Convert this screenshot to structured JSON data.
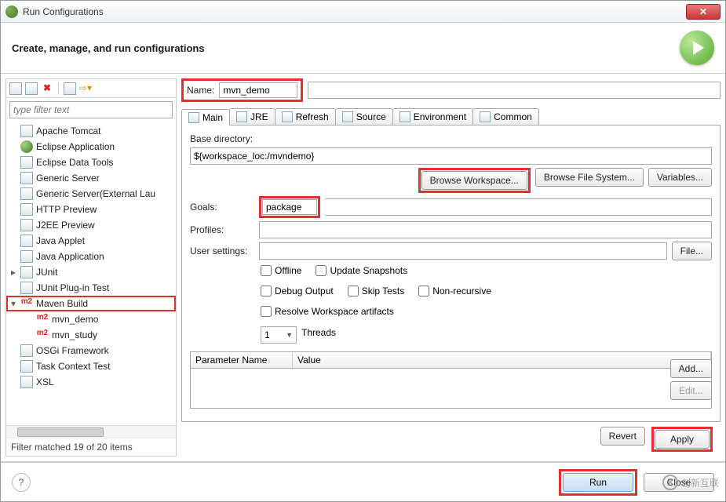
{
  "window": {
    "title": "Run Configurations",
    "close_glyph": "✕"
  },
  "header": {
    "text": "Create, manage, and run configurations"
  },
  "toolbar_icons": [
    "new-icon",
    "copy-icon",
    "delete-icon",
    "collapse-icon",
    "filter-icon"
  ],
  "filter": {
    "placeholder": "type filter text"
  },
  "tree": [
    {
      "label": "Apache Tomcat",
      "icon": "tomcat-icon"
    },
    {
      "label": "Eclipse Application",
      "icon": "eclipse-icon"
    },
    {
      "label": "Eclipse Data Tools",
      "icon": "db-icon"
    },
    {
      "label": "Generic Server",
      "icon": "server-icon"
    },
    {
      "label": "Generic Server(External Lau",
      "icon": "server-icon"
    },
    {
      "label": "HTTP Preview",
      "icon": "http-icon"
    },
    {
      "label": "J2EE Preview",
      "icon": "j2ee-icon"
    },
    {
      "label": "Java Applet",
      "icon": "applet-icon"
    },
    {
      "label": "Java Application",
      "icon": "java-icon"
    },
    {
      "label": "JUnit",
      "icon": "junit-icon",
      "expandable": true
    },
    {
      "label": "JUnit Plug-in Test",
      "icon": "junit-icon"
    },
    {
      "label": "Maven Build",
      "icon": "m2-icon",
      "highlight": true,
      "expandable": true,
      "expanded": true
    },
    {
      "label": "mvn_demo",
      "icon": "m2-icon",
      "child": true
    },
    {
      "label": "mvn_study",
      "icon": "m2-icon",
      "child": true
    },
    {
      "label": "OSGi Framework",
      "icon": "osgi-icon"
    },
    {
      "label": "Task Context Test",
      "icon": "task-icon"
    },
    {
      "label": "XSL",
      "icon": "xsl-icon"
    }
  ],
  "filter_matched": "Filter matched 19 of 20 items",
  "name": {
    "label": "Name:",
    "value": "mvn_demo"
  },
  "tabs": [
    {
      "label": "Main",
      "icon": "main-tab-icon",
      "active": true
    },
    {
      "label": "JRE",
      "icon": "jre-tab-icon"
    },
    {
      "label": "Refresh",
      "icon": "refresh-tab-icon"
    },
    {
      "label": "Source",
      "icon": "source-tab-icon"
    },
    {
      "label": "Environment",
      "icon": "env-tab-icon"
    },
    {
      "label": "Common",
      "icon": "common-tab-icon"
    }
  ],
  "form": {
    "base_dir_label": "Base directory:",
    "base_dir_value": "${workspace_loc:/mvndemo}",
    "browse_workspace": "Browse Workspace...",
    "browse_fs": "Browse File System...",
    "variables": "Variables...",
    "goals_label": "Goals:",
    "goals_value": "package",
    "profiles_label": "Profiles:",
    "profiles_value": "",
    "user_settings_label": "User settings:",
    "user_settings_value": "",
    "file_btn": "File...",
    "checks": {
      "offline": "Offline",
      "update_snapshots": "Update Snapshots",
      "debug_output": "Debug Output",
      "skip_tests": "Skip Tests",
      "non_recursive": "Non-recursive",
      "resolve_ws": "Resolve Workspace artifacts"
    },
    "threads_value": "1",
    "threads_label": "Threads",
    "param_table": {
      "col1": "Parameter Name",
      "col2": "Value"
    },
    "add_btn": "Add...",
    "edit_btn": "Edit..."
  },
  "bottom": {
    "revert": "Revert",
    "apply": "Apply"
  },
  "footer": {
    "help": "?",
    "run": "Run",
    "close": "Close"
  },
  "watermark": {
    "icon": "X",
    "text": "创新互联"
  }
}
